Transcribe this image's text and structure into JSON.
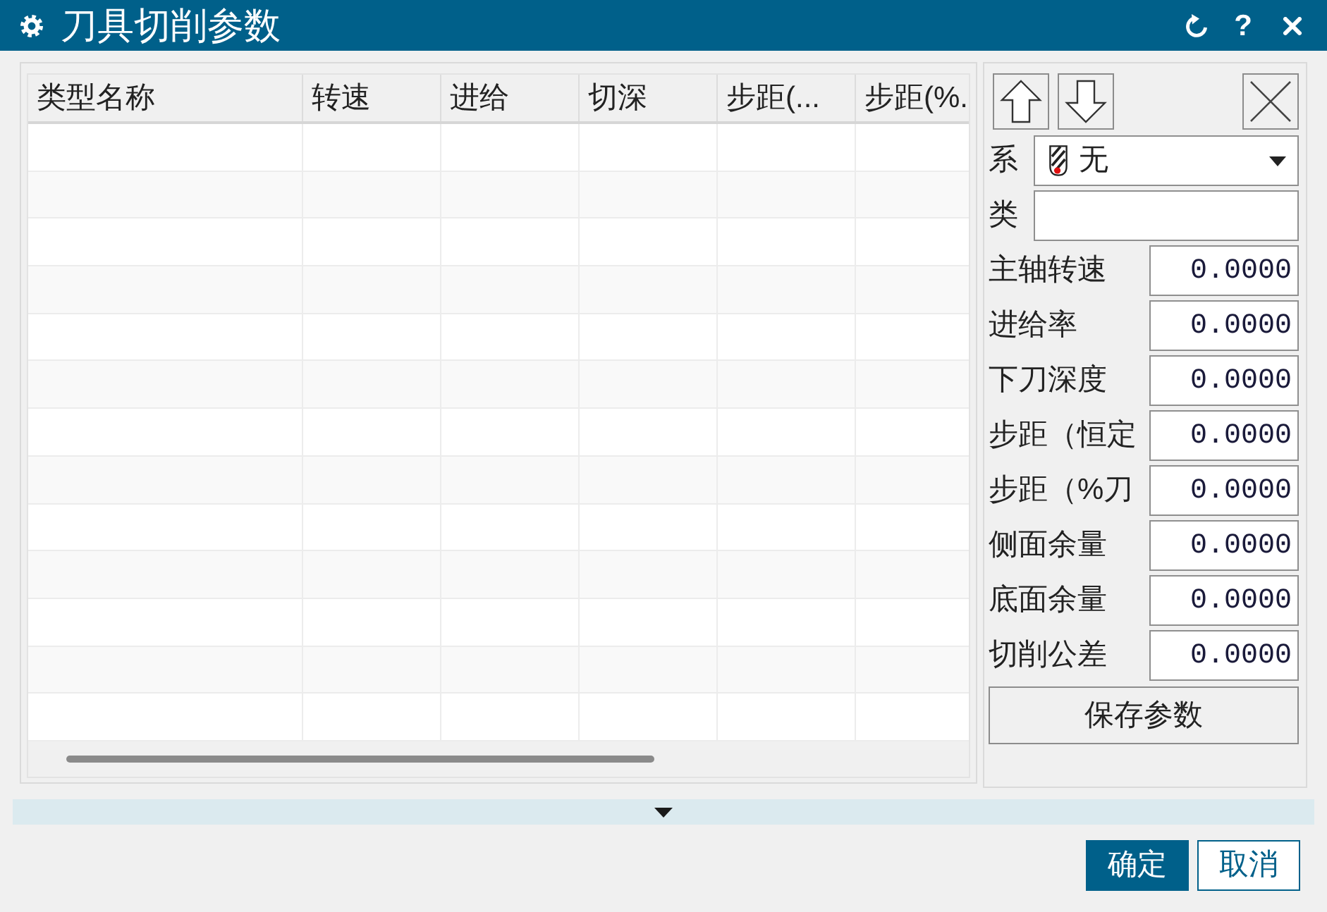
{
  "window": {
    "title": "刀具切削参数",
    "help_button": "?"
  },
  "table": {
    "columns": [
      "类型名称",
      "转速",
      "进给",
      "切深",
      "步距(...",
      "步距(%."
    ]
  },
  "side_panel": {
    "fields": [
      {
        "kind": "dropdown",
        "label": "系",
        "value": "无"
      },
      {
        "kind": "text",
        "label": "类"
      },
      {
        "kind": "number",
        "label": "主轴转速",
        "value": "0.0000"
      },
      {
        "kind": "number",
        "label": "进给率",
        "value": "0.0000"
      },
      {
        "kind": "number",
        "label": "下刀深度",
        "value": "0.0000"
      },
      {
        "kind": "number",
        "label": "步距（恒定",
        "value": "0.0000"
      },
      {
        "kind": "number",
        "label": "步距（%刀",
        "value": "0.0000"
      },
      {
        "kind": "number",
        "label": "侧面余量",
        "value": "0.0000"
      },
      {
        "kind": "number",
        "label": "底面余量",
        "value": "0.0000"
      },
      {
        "kind": "number",
        "label": "切削公差",
        "value": "0.0000"
      }
    ],
    "save_button": "保存参数"
  },
  "footer": {
    "buttons": [
      {
        "kind": "primary",
        "label": "确定"
      },
      {
        "kind": "secondary",
        "label": "取消"
      }
    ]
  }
}
